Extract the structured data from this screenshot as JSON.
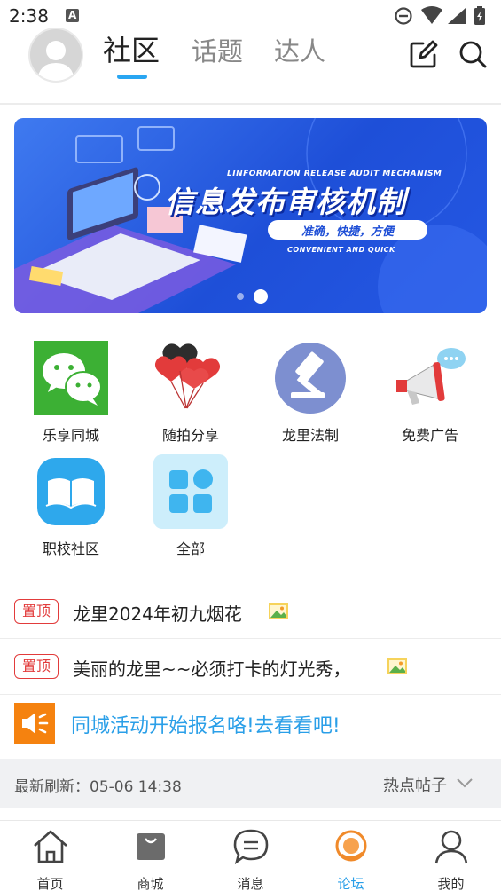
{
  "status_bar": {
    "time": "2:38",
    "notification_icon": "a-square-icon",
    "icons": [
      "do-not-disturb-icon",
      "wifi-icon",
      "signal-icon",
      "battery-icon"
    ]
  },
  "header": {
    "avatar": "avatar-placeholder",
    "tabs": [
      {
        "label": "社区",
        "active": true
      },
      {
        "label": "话题",
        "active": false
      },
      {
        "label": "达人",
        "active": false
      }
    ],
    "actions": [
      "edit-icon",
      "search-icon"
    ]
  },
  "banner": {
    "en_title": "LINFORMATION RELEASE AUDIT MECHANISM",
    "title": "信息发布审核机制",
    "pill_text": "准确，快捷，方便",
    "en_subtitle": "CONVENIENT AND QUICK",
    "page_count": 2,
    "active_page": 2
  },
  "grid": [
    {
      "label": "乐享同城",
      "icon": "wechat-icon"
    },
    {
      "label": "随拍分享",
      "icon": "heart-balloons-icon"
    },
    {
      "label": "龙里法制",
      "icon": "gavel-icon"
    },
    {
      "label": "免费广告",
      "icon": "megaphone-icon"
    },
    {
      "label": "职校社区",
      "icon": "book-icon"
    },
    {
      "label": "全部",
      "icon": "all-grid-icon"
    }
  ],
  "posts": [
    {
      "badge": "置顶",
      "title": "龙里2024年初九烟花",
      "has_image": true
    },
    {
      "badge": "置顶",
      "title": "美丽的龙里~~必须打卡的灯光秀，",
      "has_image": true
    }
  ],
  "notice": {
    "icon": "speaker-icon",
    "text": "同城活动开始报名咯!去看看吧!"
  },
  "refresh": {
    "label": "最新刷新：05-06 14:38",
    "sort_label": "热点帖子"
  },
  "bottom_nav": [
    {
      "label": "首页",
      "icon": "home-icon",
      "active": false
    },
    {
      "label": "商城",
      "icon": "shopping-bag-icon",
      "active": false
    },
    {
      "label": "消息",
      "icon": "chat-bubble-icon",
      "active": false
    },
    {
      "label": "论坛",
      "icon": "forum-icon",
      "active": true
    },
    {
      "label": "我的",
      "icon": "person-icon",
      "active": false
    }
  ],
  "colors": {
    "accent": "#29a6f2",
    "pin_red": "#e23b3b",
    "notice_orange": "#f5820f",
    "banner_blue": "#2558e4"
  }
}
